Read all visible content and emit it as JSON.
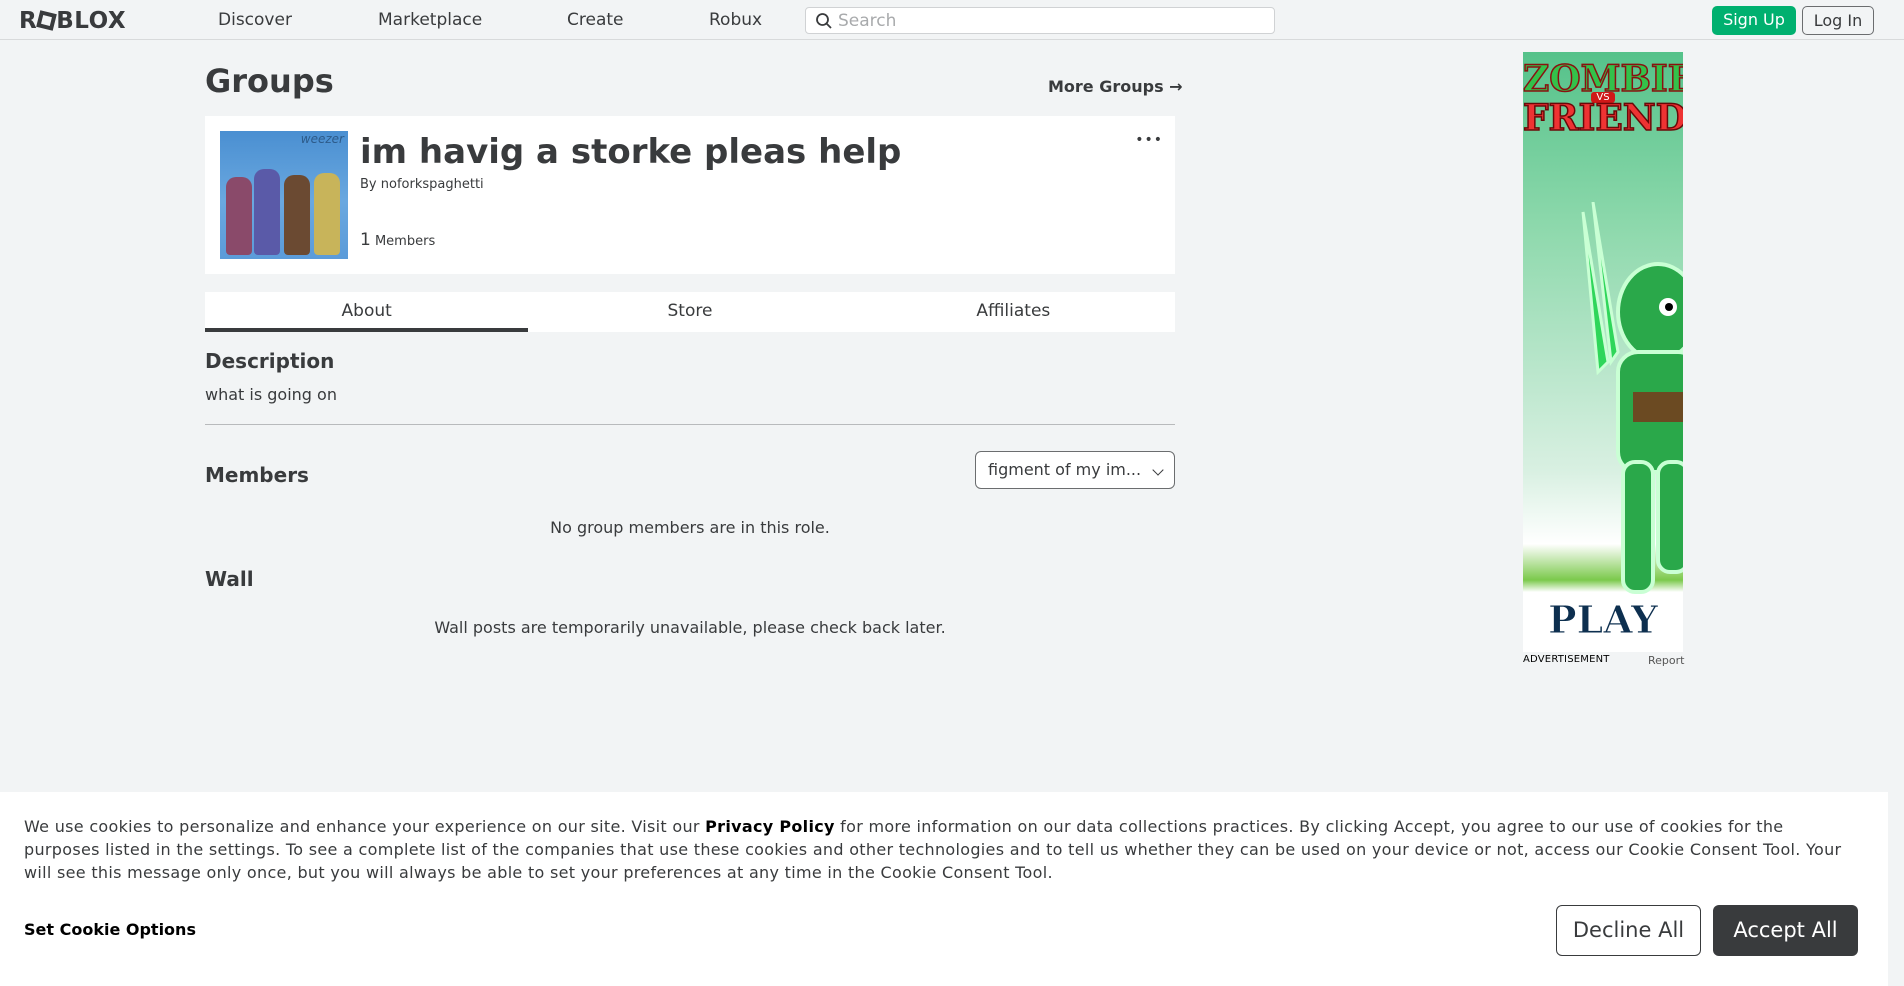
{
  "nav": {
    "logo": "ROBLOX",
    "links": [
      "Discover",
      "Marketplace",
      "Create",
      "Robux"
    ],
    "search_placeholder": "Search",
    "signup": "Sign Up",
    "login": "Log In"
  },
  "page": {
    "title": "Groups",
    "more_groups": "More Groups →"
  },
  "group": {
    "emblem_brand": "weezer",
    "name": "im havig a storke pleas help",
    "owner_prefix": "By",
    "owner": "noforkspaghetti",
    "member_count": "1",
    "member_label": "Members",
    "menu": "•••"
  },
  "tabs": [
    "About",
    "Store",
    "Affiliates"
  ],
  "description": {
    "title": "Description",
    "text": "what is going on"
  },
  "members": {
    "title": "Members",
    "role_selected": "figment of my im...",
    "empty_msg": "No group members are in this role."
  },
  "wall": {
    "title": "Wall",
    "msg": "Wall posts are temporarily unavailable, please check back later."
  },
  "ad": {
    "title_top": "ZOMBIE",
    "title_vs": "VS",
    "title_bottom": "FRIEND",
    "cta": "PLAY",
    "label": "ADVERTISEMENT",
    "report": "Report"
  },
  "cookie": {
    "text_before": "We use cookies to personalize and enhance your experience on our site. Visit our ",
    "privacy_link": "Privacy Policy",
    "text_after": " for more information on our data collections practices. By clicking Accept, you agree to our use of cookies for the purposes listed in the settings. To see a complete list of the companies that use these cookies and other technologies and to tell us whether they can be used on your device or not, access our Cookie Consent Tool. Your will see this message only once, but you will always be able to set your preferences at any time in the Cookie Consent Tool.",
    "options": "Set Cookie Options",
    "decline": "Decline All",
    "accept": "Accept All"
  },
  "colors": {
    "background": "#f2f4f5",
    "primary_text": "#393b3d",
    "signup_green": "#00b06f",
    "card": "#ffffff"
  }
}
